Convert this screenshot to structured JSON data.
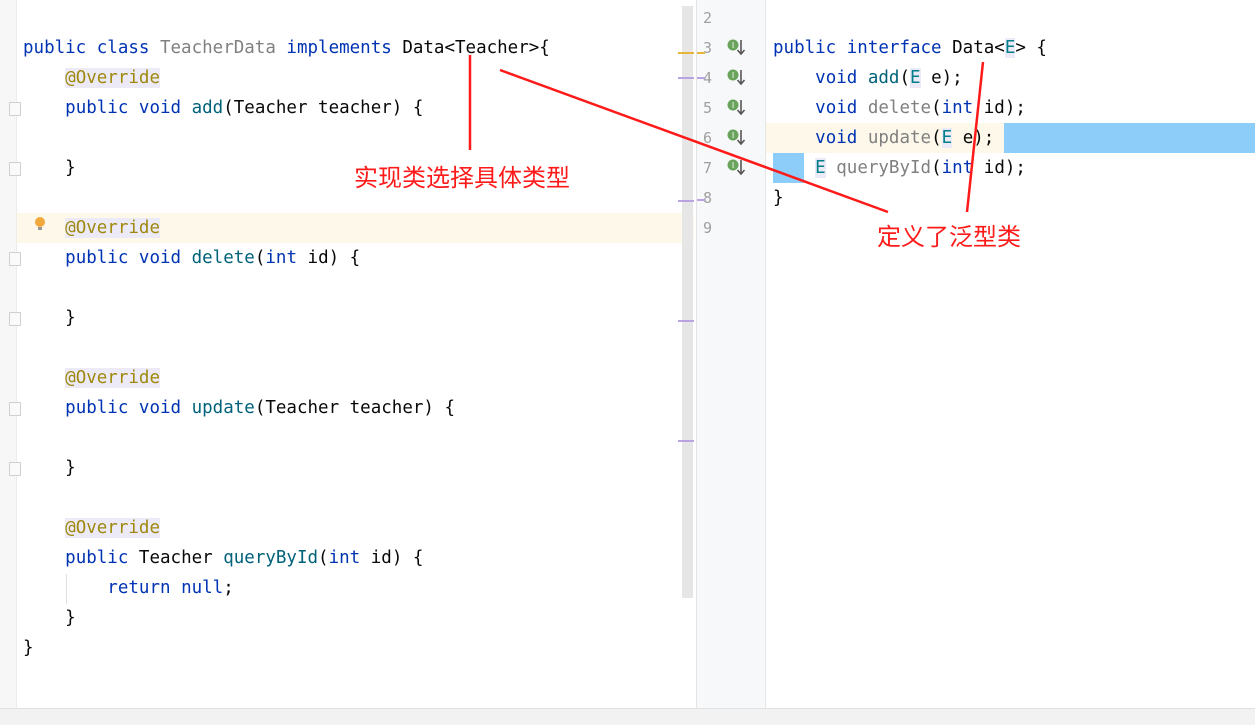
{
  "left_editor": {
    "lines": [
      [
        [
          "public ",
          "kw"
        ],
        [
          "class ",
          "kw"
        ],
        [
          "TeacherData ",
          "gray"
        ],
        [
          "implements ",
          "kw"
        ],
        [
          "Data<Teacher>{",
          ""
        ]
      ],
      [
        [
          "    ",
          ""
        ],
        [
          "@Override",
          "ann"
        ]
      ],
      [
        [
          "    ",
          ""
        ],
        [
          "public ",
          "kw"
        ],
        [
          "void ",
          "kw"
        ],
        [
          "add",
          "fn"
        ],
        [
          "(Teacher teacher) {",
          ""
        ]
      ],
      [],
      [
        [
          "    }",
          ""
        ]
      ],
      [],
      [
        [
          "    ",
          ""
        ],
        [
          "@Override",
          "ann"
        ]
      ],
      [
        [
          "    ",
          ""
        ],
        [
          "public ",
          "kw"
        ],
        [
          "void ",
          "kw"
        ],
        [
          "delete",
          "fn"
        ],
        [
          "(",
          ""
        ],
        [
          "int ",
          "kw"
        ],
        [
          "id) {",
          ""
        ]
      ],
      [],
      [
        [
          "    }",
          ""
        ]
      ],
      [],
      [
        [
          "    ",
          ""
        ],
        [
          "@Override",
          "ann"
        ]
      ],
      [
        [
          "    ",
          ""
        ],
        [
          "public ",
          "kw"
        ],
        [
          "void ",
          "kw"
        ],
        [
          "update",
          "fn"
        ],
        [
          "(Teacher teacher) {",
          ""
        ]
      ],
      [],
      [
        [
          "    }",
          ""
        ]
      ],
      [],
      [
        [
          "    ",
          ""
        ],
        [
          "@Override",
          "ann"
        ]
      ],
      [
        [
          "    ",
          ""
        ],
        [
          "public ",
          "kw"
        ],
        [
          "Teacher ",
          ""
        ],
        [
          "queryById",
          "fn"
        ],
        [
          "(",
          ""
        ],
        [
          "int ",
          "kw"
        ],
        [
          "id) {",
          ""
        ]
      ],
      [
        [
          "        ",
          ""
        ],
        [
          "return ",
          "kw"
        ],
        [
          "null",
          "kw"
        ],
        [
          ";",
          ""
        ]
      ],
      [
        [
          "    }",
          ""
        ]
      ],
      [
        [
          "}",
          ""
        ]
      ]
    ]
  },
  "right_editor": {
    "line_numbers": [
      "2",
      "3",
      "4",
      "5",
      "6",
      "7",
      "8",
      "9"
    ],
    "lines": [
      [],
      [
        [
          "public ",
          "kw"
        ],
        [
          "interface ",
          "kw"
        ],
        [
          "Data<",
          ""
        ],
        [
          "E",
          "tp"
        ],
        [
          "> {",
          ""
        ]
      ],
      [
        [
          "    ",
          ""
        ],
        [
          "void ",
          "kw"
        ],
        [
          "add",
          "fn"
        ],
        [
          "(",
          ""
        ],
        [
          "E",
          "tp"
        ],
        [
          " e);",
          ""
        ]
      ],
      [
        [
          "    ",
          ""
        ],
        [
          "void ",
          "kw"
        ],
        [
          "delete",
          "gray"
        ],
        [
          "(",
          ""
        ],
        [
          "int ",
          "kw"
        ],
        [
          "id);",
          ""
        ]
      ],
      [
        [
          "    ",
          ""
        ],
        [
          "void ",
          "kw"
        ],
        [
          "update",
          "gray"
        ],
        [
          "(",
          ""
        ],
        [
          "E",
          "tp"
        ],
        [
          " e);",
          ""
        ]
      ],
      [
        [
          "    ",
          ""
        ],
        [
          "E",
          "tp"
        ],
        [
          " ",
          ""
        ],
        [
          "queryById",
          "gray"
        ],
        [
          "(",
          ""
        ],
        [
          "int ",
          "kw"
        ],
        [
          "id);",
          ""
        ]
      ],
      [
        [
          "}",
          ""
        ]
      ],
      []
    ],
    "implemented_icon_lines": [
      "3",
      "4",
      "5",
      "6",
      "7"
    ]
  },
  "annotations": {
    "left_label": "实现类选择具体类型",
    "right_label": "定义了泛型类",
    "color": "#ff1a1a"
  },
  "icons": {
    "gutter_icon": "implemented-arrow-icon",
    "hint_icon": "lightbulb-icon"
  }
}
